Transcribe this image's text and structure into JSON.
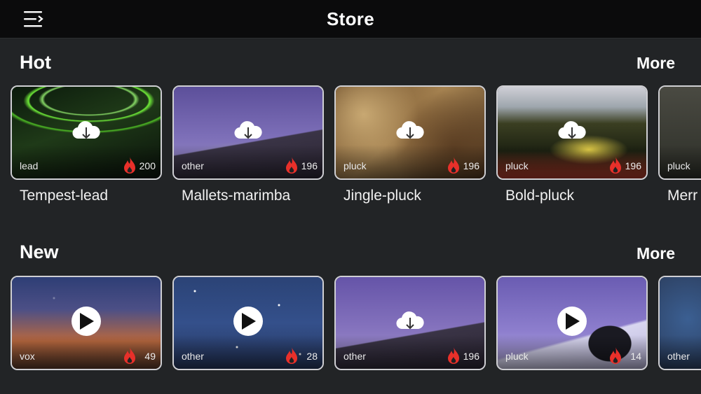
{
  "header": {
    "title": "Store",
    "menu_icon": "menu-lines-icon"
  },
  "sections": [
    {
      "title": "Hot",
      "more_label": "More",
      "cards": [
        {
          "name": "Tempest-lead",
          "tag": "lead",
          "count": "200",
          "overlay": "cloud-download"
        },
        {
          "name": "Mallets-marimba",
          "tag": "other",
          "count": "196",
          "overlay": "cloud-download"
        },
        {
          "name": "Jingle-pluck",
          "tag": "pluck",
          "count": "196",
          "overlay": "cloud-download"
        },
        {
          "name": "Bold-pluck",
          "tag": "pluck",
          "count": "196",
          "overlay": "cloud-download"
        },
        {
          "name": "Merr",
          "tag": "pluck",
          "count": "",
          "overlay": "none"
        }
      ]
    },
    {
      "title": "New",
      "more_label": "More",
      "cards": [
        {
          "name": "",
          "tag": "vox",
          "count": "49",
          "overlay": "play"
        },
        {
          "name": "",
          "tag": "other",
          "count": "28",
          "overlay": "play"
        },
        {
          "name": "",
          "tag": "other",
          "count": "196",
          "overlay": "cloud-download"
        },
        {
          "name": "",
          "tag": "pluck",
          "count": "14",
          "overlay": "play"
        },
        {
          "name": "",
          "tag": "other",
          "count": "",
          "overlay": "none"
        }
      ]
    }
  ],
  "colors": {
    "background": "#222426",
    "header": "#0b0b0c",
    "flame": "#e8302a",
    "card_border": "#cfcfd3"
  }
}
